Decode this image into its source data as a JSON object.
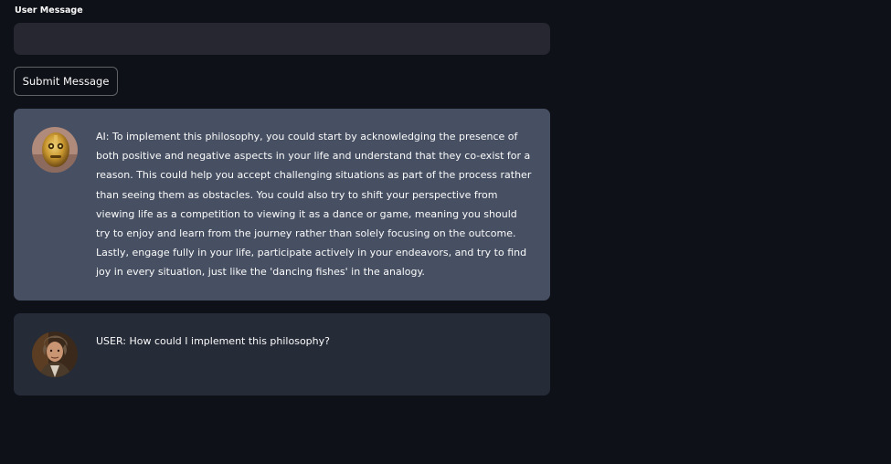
{
  "form": {
    "input_label": "User Message",
    "input_value": "",
    "input_placeholder": "",
    "submit_label": "Submit Message"
  },
  "messages": [
    {
      "role": "ai",
      "avatar_icon": "robot-avatar-icon",
      "text": "AI: To implement this philosophy, you could start by acknowledging the presence of both positive and negative aspects in your life and understand that they co-exist for a reason. This could help you accept challenging situations as part of the process rather than seeing them as obstacles. You could also try to shift your perspective from viewing life as a competition to viewing it as a dance or game, meaning you should try to enjoy and learn from the journey rather than solely focusing on the outcome. Lastly, engage fully in your life, participate actively in your endeavors, and try to find joy in every situation, just like the 'dancing fishes' in the analogy."
    },
    {
      "role": "user",
      "avatar_icon": "user-photo-avatar-icon",
      "text": "USER: How could I implement this philosophy?"
    }
  ],
  "colors": {
    "background": "#0e1117",
    "input_bg": "#262730",
    "ai_message_bg": "#475063",
    "user_message_bg": "#262b38",
    "text": "#fafafa"
  }
}
